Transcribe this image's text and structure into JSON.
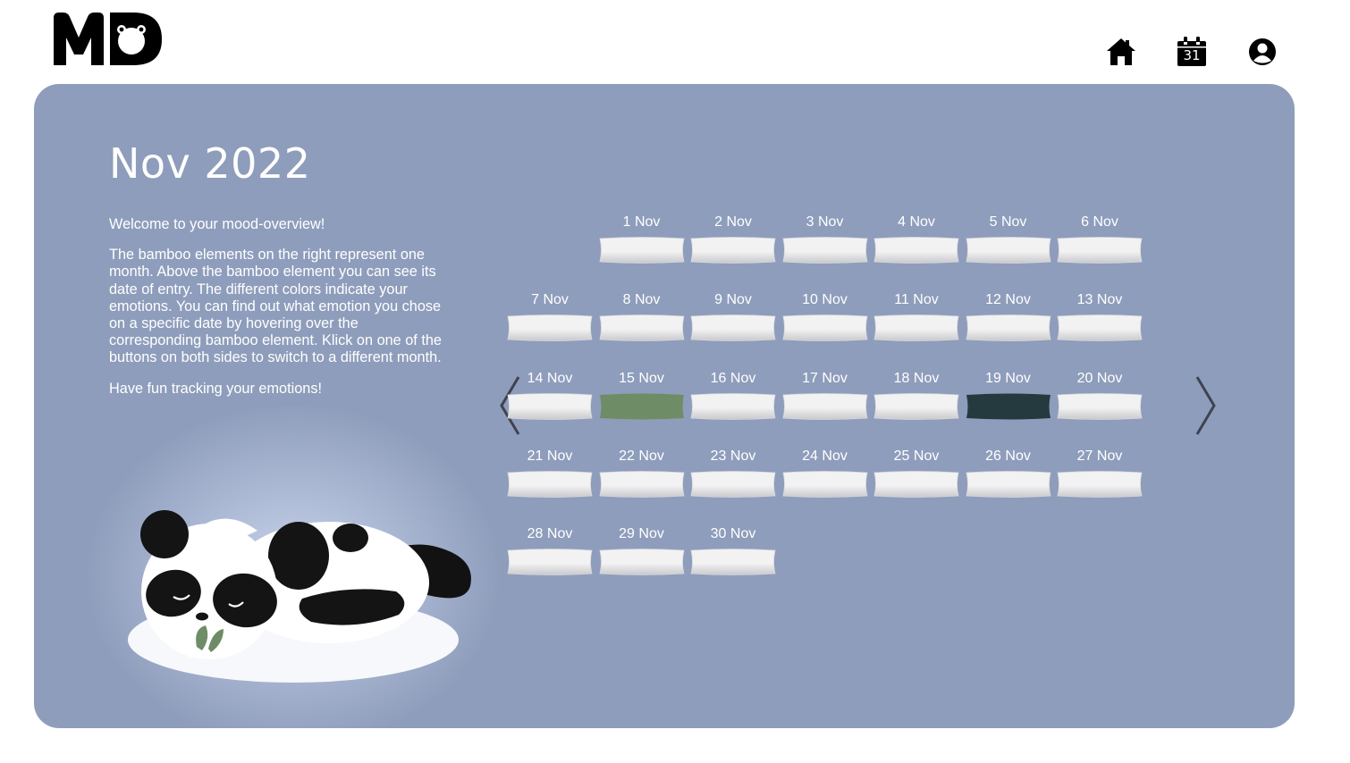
{
  "header": {
    "logo_text": "MD",
    "nav": [
      {
        "name": "home-icon"
      },
      {
        "name": "calendar-icon",
        "day": "31"
      },
      {
        "name": "profile-icon"
      }
    ]
  },
  "overview": {
    "month_title": "Nov 2022",
    "paragraphs": [
      "Welcome to your mood-overview!",
      "The bamboo elements on the right represent one month. Above the bamboo element you can see its date of entry. The different colors indicate your emotions. You can find out what emotion you chose on a specific date by hovering over the corresponding bamboo element. Klick on one of the buttons on both sides to switch to a different month.",
      "Have fun tracking your emotions!"
    ],
    "nav_arrows": {
      "prev": "chevron-left-icon",
      "next": "chevron-right-icon"
    }
  },
  "calendar": {
    "first_weekday_index": 1,
    "colors": {
      "empty": "#f2f2f2",
      "green": "#6e8c66",
      "dark": "#243a3e"
    },
    "days": [
      {
        "label": "1 Nov",
        "mood": "empty"
      },
      {
        "label": "2 Nov",
        "mood": "empty"
      },
      {
        "label": "3 Nov",
        "mood": "empty"
      },
      {
        "label": "4 Nov",
        "mood": "empty"
      },
      {
        "label": "5 Nov",
        "mood": "empty"
      },
      {
        "label": "6 Nov",
        "mood": "empty"
      },
      {
        "label": "7 Nov",
        "mood": "empty"
      },
      {
        "label": "8 Nov",
        "mood": "empty"
      },
      {
        "label": "9 Nov",
        "mood": "empty"
      },
      {
        "label": "10 Nov",
        "mood": "empty"
      },
      {
        "label": "11 Nov",
        "mood": "empty"
      },
      {
        "label": "12 Nov",
        "mood": "empty"
      },
      {
        "label": "13 Nov",
        "mood": "empty"
      },
      {
        "label": "14 Nov",
        "mood": "empty"
      },
      {
        "label": "15 Nov",
        "mood": "green"
      },
      {
        "label": "16 Nov",
        "mood": "empty"
      },
      {
        "label": "17 Nov",
        "mood": "empty"
      },
      {
        "label": "18 Nov",
        "mood": "empty"
      },
      {
        "label": "19 Nov",
        "mood": "dark"
      },
      {
        "label": "20 Nov",
        "mood": "empty"
      },
      {
        "label": "21 Nov",
        "mood": "empty"
      },
      {
        "label": "22 Nov",
        "mood": "empty"
      },
      {
        "label": "23 Nov",
        "mood": "empty"
      },
      {
        "label": "24 Nov",
        "mood": "empty"
      },
      {
        "label": "25 Nov",
        "mood": "empty"
      },
      {
        "label": "26 Nov",
        "mood": "empty"
      },
      {
        "label": "27 Nov",
        "mood": "empty"
      },
      {
        "label": "28 Nov",
        "mood": "empty"
      },
      {
        "label": "29 Nov",
        "mood": "empty"
      },
      {
        "label": "30 Nov",
        "mood": "empty"
      }
    ]
  }
}
